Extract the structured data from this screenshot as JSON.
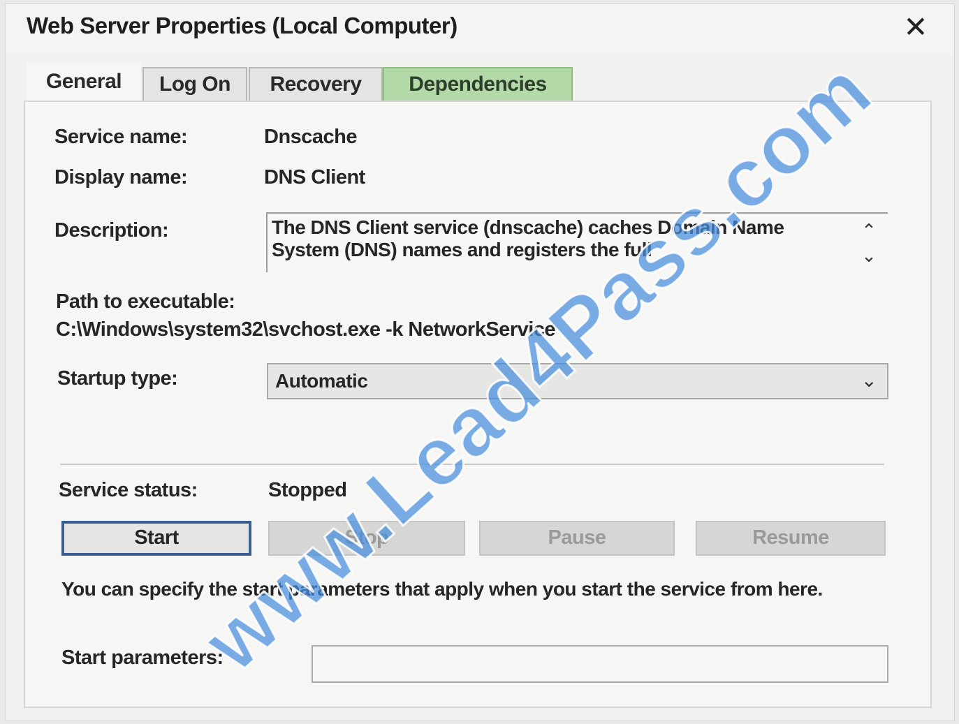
{
  "window": {
    "title": "Web Server Properties (Local Computer)",
    "close_glyph": "✕"
  },
  "tabs": [
    {
      "label": "General",
      "active": true
    },
    {
      "label": "Log On",
      "active": false
    },
    {
      "label": "Recovery",
      "active": false
    },
    {
      "label": "Dependencies",
      "active": false,
      "highlighted": true
    }
  ],
  "general": {
    "service_name_label": "Service name:",
    "service_name": "Dnscache",
    "display_name_label": "Display name:",
    "display_name": "DNS Client",
    "description_label": "Description:",
    "description": "The DNS Client service (dnscache) caches Domain Name System (DNS) names and registers the full",
    "path_label": "Path to executable:",
    "path": "C:\\Windows\\system32\\svchost.exe -k NetworkService",
    "startup_type_label": "Startup type:",
    "startup_type": "Automatic",
    "service_status_label": "Service status:",
    "service_status": "Stopped",
    "buttons": {
      "start": "Start",
      "stop": "Stop",
      "pause": "Pause",
      "resume": "Resume"
    },
    "info_text": "You can specify the start parameters that apply when you start the service from here.",
    "start_params_label": "Start parameters:",
    "start_params_value": ""
  },
  "watermark": "www.Lead4Pass.com",
  "colors": {
    "dependencies_tab": "#b4d9a8",
    "focus_border": "#3b5e93",
    "watermark": "#468cdc"
  }
}
